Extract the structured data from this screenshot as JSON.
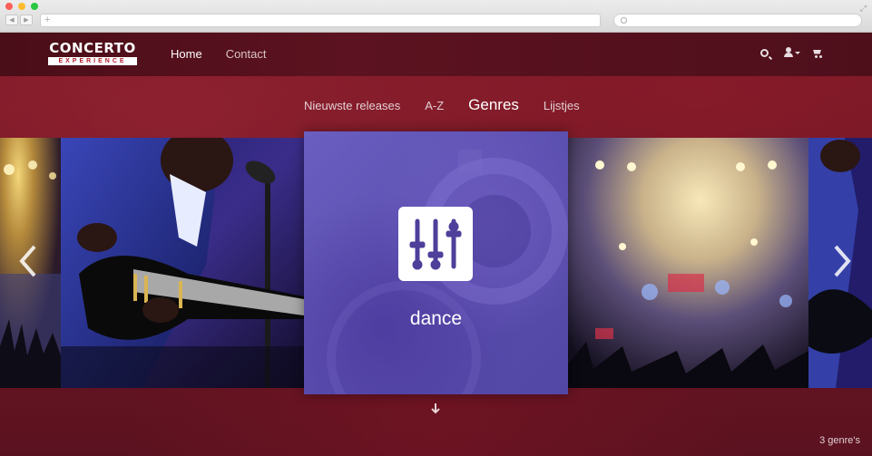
{
  "browser": {
    "address_placeholder": "+",
    "back_label": "◀",
    "forward_label": "▶",
    "expand_label": "⤢"
  },
  "header": {
    "logo": {
      "top": "CONCERTO",
      "bottom": "EXPERIENCE"
    },
    "nav": [
      {
        "label": "Home",
        "active": true
      },
      {
        "label": "Contact",
        "active": false
      }
    ],
    "icons": [
      "search-icon",
      "user-icon",
      "cart-icon"
    ]
  },
  "subnav": [
    {
      "label": "Nieuwste releases",
      "active": false
    },
    {
      "label": "A-Z",
      "active": false
    },
    {
      "label": "Genres",
      "active": true
    },
    {
      "label": "Lijstjes",
      "active": false
    }
  ],
  "carousel": {
    "center": {
      "label": "dance",
      "icon": "mixer-sliders-icon"
    },
    "colors": {
      "center_overlay": "#5b4fb0",
      "accent": "#b11b2c",
      "background": "#6c1522"
    }
  },
  "footer": {
    "count": "3 genre's"
  }
}
